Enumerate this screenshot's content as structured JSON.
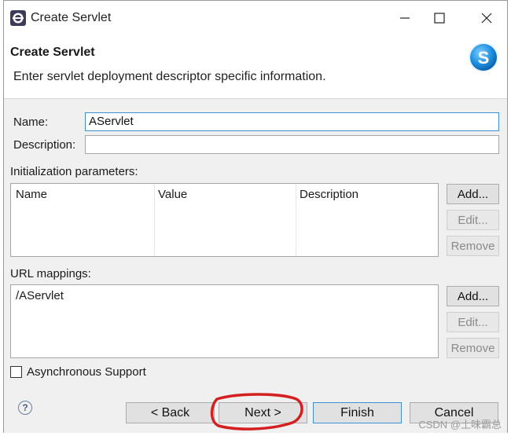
{
  "window": {
    "title": "Create Servlet"
  },
  "banner": {
    "title": "Create Servlet",
    "description": "Enter servlet deployment descriptor specific information."
  },
  "form": {
    "name_label": "Name:",
    "name_value": "AServlet",
    "description_label": "Description:",
    "description_value": ""
  },
  "init_params": {
    "label": "Initialization parameters:",
    "columns": [
      "Name",
      "Value",
      "Description"
    ],
    "buttons": {
      "add": "Add...",
      "edit": "Edit...",
      "remove": "Remove"
    }
  },
  "url_mappings": {
    "label": "URL mappings:",
    "items": [
      "/AServlet"
    ],
    "buttons": {
      "add": "Add...",
      "edit": "Edit...",
      "remove": "Remove"
    }
  },
  "async_support": {
    "label": "Asynchronous Support",
    "checked": false
  },
  "footer": {
    "back": "< Back",
    "next": "Next >",
    "finish": "Finish",
    "cancel": "Cancel"
  },
  "watermark": "CSDN @土味霸总",
  "colors": {
    "focus_border": "#3b8fd4",
    "annotation": "#d42020"
  }
}
